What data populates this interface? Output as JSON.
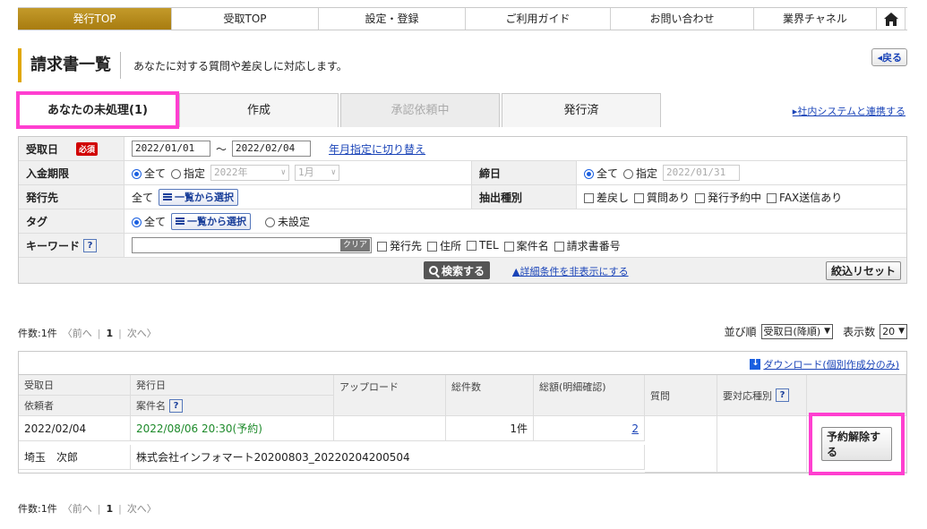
{
  "nav": {
    "items": [
      "発行TOP",
      "受取TOP",
      "設定・登録",
      "ご利用ガイド",
      "お問い合わせ",
      "業界チャネル"
    ],
    "home_icon": "home-icon"
  },
  "page": {
    "title": "請求書一覧",
    "description": "あなたに対する質問や差戻しに対応します。",
    "back_label": "◂戻る"
  },
  "tabs": [
    "あなたの未処理(1)",
    "作成",
    "承認依頼中",
    "発行済"
  ],
  "external_link": "▸社内システムと連携する",
  "form": {
    "received_date": {
      "label": "受取日",
      "required": "必須",
      "from": "2022/01/01",
      "sep": "～",
      "to": "2022/02/04",
      "toggle_link": "年月指定に切り替え"
    },
    "payment_due": {
      "label": "入金期限",
      "all": "全て",
      "specify": "指定",
      "year": "2022年",
      "month": "1月"
    },
    "closing": {
      "label": "締日",
      "all": "全て",
      "specify": "指定",
      "date": "2022/01/31"
    },
    "issuer": {
      "label": "発行先",
      "value": "全て",
      "select_btn": "一覧から選択"
    },
    "extract": {
      "label": "抽出種別",
      "options": [
        "差戻し",
        "質問あり",
        "発行予約中",
        "FAX送信あり"
      ]
    },
    "tag": {
      "label": "タグ",
      "all": "全て",
      "select_btn": "一覧から選択",
      "unset": "未設定"
    },
    "keyword": {
      "label": "キーワード",
      "help": "?",
      "clear": "クリア",
      "options": [
        "発行先",
        "住所",
        "TEL",
        "案件名",
        "請求書番号"
      ]
    },
    "search_btn": "検索する",
    "hide_link": "▲詳細条件を非表示にする",
    "reset_btn": "絞込リセット"
  },
  "pager": {
    "count": "件数:1件",
    "prev": "〈前へ",
    "page": "1",
    "next": "次へ〉"
  },
  "sort": {
    "label": "並び順",
    "value": "受取日(降順)",
    "per_label": "表示数",
    "per_value": "20"
  },
  "table": {
    "download_link": "ダウンロード(個別作成分のみ)",
    "headers_top": [
      "受取日",
      "発行日",
      "アップロード",
      "総件数",
      "総額(明細確認)",
      "質問",
      "要対応種別"
    ],
    "headers_bottom": [
      "依頼者",
      "案件名"
    ],
    "help": "?",
    "row": {
      "received": "2022/02/04",
      "issued": "2022/08/06 20:30(予約)",
      "count": "1件",
      "amount": "2",
      "requester": "埼玉　次郎",
      "project": "株式会社インフォマート20200803_20220204200504",
      "action": "予約解除する"
    }
  }
}
